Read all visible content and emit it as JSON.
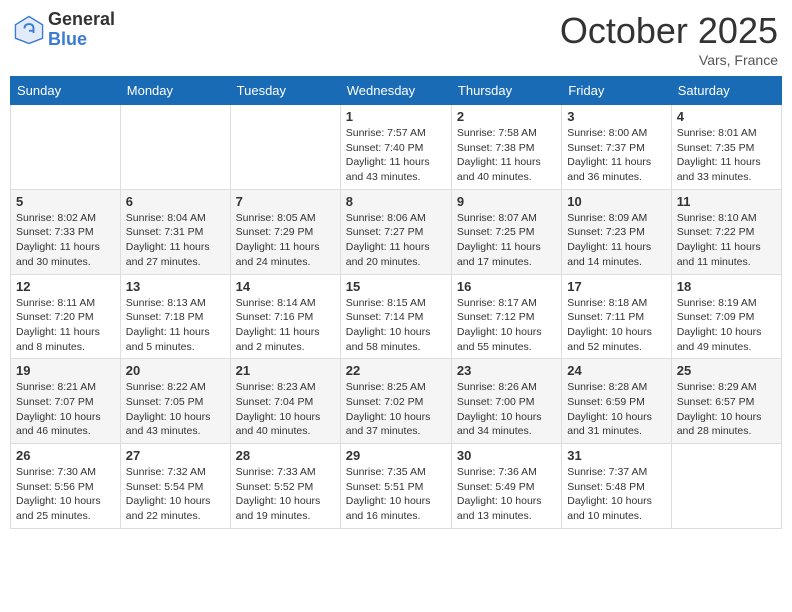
{
  "header": {
    "logo_general": "General",
    "logo_blue": "Blue",
    "month_title": "October 2025",
    "location": "Vars, France"
  },
  "weekdays": [
    "Sunday",
    "Monday",
    "Tuesday",
    "Wednesday",
    "Thursday",
    "Friday",
    "Saturday"
  ],
  "weeks": [
    [
      {
        "day": "",
        "info": ""
      },
      {
        "day": "",
        "info": ""
      },
      {
        "day": "",
        "info": ""
      },
      {
        "day": "1",
        "info": "Sunrise: 7:57 AM\nSunset: 7:40 PM\nDaylight: 11 hours and 43 minutes."
      },
      {
        "day": "2",
        "info": "Sunrise: 7:58 AM\nSunset: 7:38 PM\nDaylight: 11 hours and 40 minutes."
      },
      {
        "day": "3",
        "info": "Sunrise: 8:00 AM\nSunset: 7:37 PM\nDaylight: 11 hours and 36 minutes."
      },
      {
        "day": "4",
        "info": "Sunrise: 8:01 AM\nSunset: 7:35 PM\nDaylight: 11 hours and 33 minutes."
      }
    ],
    [
      {
        "day": "5",
        "info": "Sunrise: 8:02 AM\nSunset: 7:33 PM\nDaylight: 11 hours and 30 minutes."
      },
      {
        "day": "6",
        "info": "Sunrise: 8:04 AM\nSunset: 7:31 PM\nDaylight: 11 hours and 27 minutes."
      },
      {
        "day": "7",
        "info": "Sunrise: 8:05 AM\nSunset: 7:29 PM\nDaylight: 11 hours and 24 minutes."
      },
      {
        "day": "8",
        "info": "Sunrise: 8:06 AM\nSunset: 7:27 PM\nDaylight: 11 hours and 20 minutes."
      },
      {
        "day": "9",
        "info": "Sunrise: 8:07 AM\nSunset: 7:25 PM\nDaylight: 11 hours and 17 minutes."
      },
      {
        "day": "10",
        "info": "Sunrise: 8:09 AM\nSunset: 7:23 PM\nDaylight: 11 hours and 14 minutes."
      },
      {
        "day": "11",
        "info": "Sunrise: 8:10 AM\nSunset: 7:22 PM\nDaylight: 11 hours and 11 minutes."
      }
    ],
    [
      {
        "day": "12",
        "info": "Sunrise: 8:11 AM\nSunset: 7:20 PM\nDaylight: 11 hours and 8 minutes."
      },
      {
        "day": "13",
        "info": "Sunrise: 8:13 AM\nSunset: 7:18 PM\nDaylight: 11 hours and 5 minutes."
      },
      {
        "day": "14",
        "info": "Sunrise: 8:14 AM\nSunset: 7:16 PM\nDaylight: 11 hours and 2 minutes."
      },
      {
        "day": "15",
        "info": "Sunrise: 8:15 AM\nSunset: 7:14 PM\nDaylight: 10 hours and 58 minutes."
      },
      {
        "day": "16",
        "info": "Sunrise: 8:17 AM\nSunset: 7:12 PM\nDaylight: 10 hours and 55 minutes."
      },
      {
        "day": "17",
        "info": "Sunrise: 8:18 AM\nSunset: 7:11 PM\nDaylight: 10 hours and 52 minutes."
      },
      {
        "day": "18",
        "info": "Sunrise: 8:19 AM\nSunset: 7:09 PM\nDaylight: 10 hours and 49 minutes."
      }
    ],
    [
      {
        "day": "19",
        "info": "Sunrise: 8:21 AM\nSunset: 7:07 PM\nDaylight: 10 hours and 46 minutes."
      },
      {
        "day": "20",
        "info": "Sunrise: 8:22 AM\nSunset: 7:05 PM\nDaylight: 10 hours and 43 minutes."
      },
      {
        "day": "21",
        "info": "Sunrise: 8:23 AM\nSunset: 7:04 PM\nDaylight: 10 hours and 40 minutes."
      },
      {
        "day": "22",
        "info": "Sunrise: 8:25 AM\nSunset: 7:02 PM\nDaylight: 10 hours and 37 minutes."
      },
      {
        "day": "23",
        "info": "Sunrise: 8:26 AM\nSunset: 7:00 PM\nDaylight: 10 hours and 34 minutes."
      },
      {
        "day": "24",
        "info": "Sunrise: 8:28 AM\nSunset: 6:59 PM\nDaylight: 10 hours and 31 minutes."
      },
      {
        "day": "25",
        "info": "Sunrise: 8:29 AM\nSunset: 6:57 PM\nDaylight: 10 hours and 28 minutes."
      }
    ],
    [
      {
        "day": "26",
        "info": "Sunrise: 7:30 AM\nSunset: 5:56 PM\nDaylight: 10 hours and 25 minutes."
      },
      {
        "day": "27",
        "info": "Sunrise: 7:32 AM\nSunset: 5:54 PM\nDaylight: 10 hours and 22 minutes."
      },
      {
        "day": "28",
        "info": "Sunrise: 7:33 AM\nSunset: 5:52 PM\nDaylight: 10 hours and 19 minutes."
      },
      {
        "day": "29",
        "info": "Sunrise: 7:35 AM\nSunset: 5:51 PM\nDaylight: 10 hours and 16 minutes."
      },
      {
        "day": "30",
        "info": "Sunrise: 7:36 AM\nSunset: 5:49 PM\nDaylight: 10 hours and 13 minutes."
      },
      {
        "day": "31",
        "info": "Sunrise: 7:37 AM\nSunset: 5:48 PM\nDaylight: 10 hours and 10 minutes."
      },
      {
        "day": "",
        "info": ""
      }
    ]
  ]
}
